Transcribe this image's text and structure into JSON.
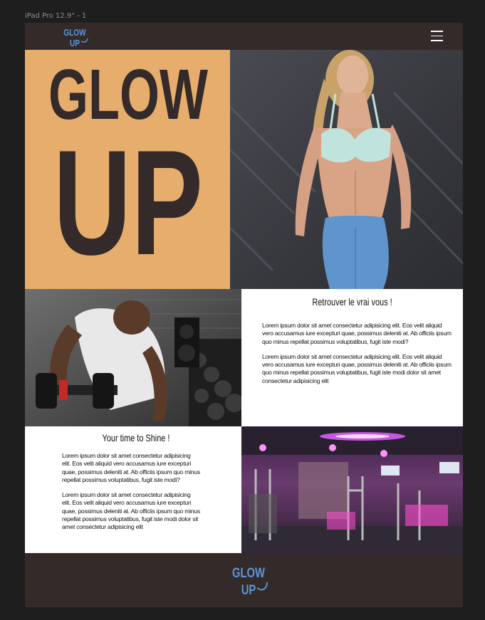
{
  "frame_label": "iPad Pro 12.9\" - 1",
  "brand": {
    "logo_line1": "GLOW",
    "logo_line2": "UP",
    "hero_line1": "GLOW",
    "hero_line2": "UP"
  },
  "colors": {
    "canvas": "#1e1e1e",
    "header_bg": "#332a29",
    "hero_accent": "#e6ad6c",
    "logo_blue": "#5c95d6",
    "text": "#111111"
  },
  "icons": {
    "menu": "hamburger-menu-icon"
  },
  "hero": {
    "slide_count": 3
  },
  "section1": {
    "title": "Retrouver le vrai vous !",
    "paragraph1": "Lorem ipsum dolor sit amet consectetur adipisicing elit. Eos velit aliquid vero accusamus iure excepturi quae, possimus deleniti at. Ab officiis ipsum quo minus repellat possimus voluptatibus, fugit iste modi?",
    "paragraph2": "Lorem ipsum dolor sit amet consectetur adipisicing elit. Eos velit aliquid vero accusamus iure excepturi quae, possimus deleniti at. Ab officiis ipsum quo minus repellat possimus voluptatibus, fugit iste modi dolor sit amet consectetur adipisicing elit"
  },
  "section2": {
    "title": "Your time to Shine !",
    "paragraph1": "Lorem ipsum dolor sit amet consectetur adipisicing elit. Eos velit aliquid vero accusamus iure excepturi quae, possimus deleniti at. Ab officiis ipsum quo minus repellat possimus voluptatibus, fugit iste modi?",
    "paragraph2": "Lorem ipsum dolor sit amet consectetur adipisicing elit. Eos velit aliquid vero accusamus iure excepturi quae, possimus deleniti at. Ab officiis ipsum quo minus repellat possimus voluptatibus, fugit iste modi dolor sit amet consectetur adipisicing elit"
  }
}
